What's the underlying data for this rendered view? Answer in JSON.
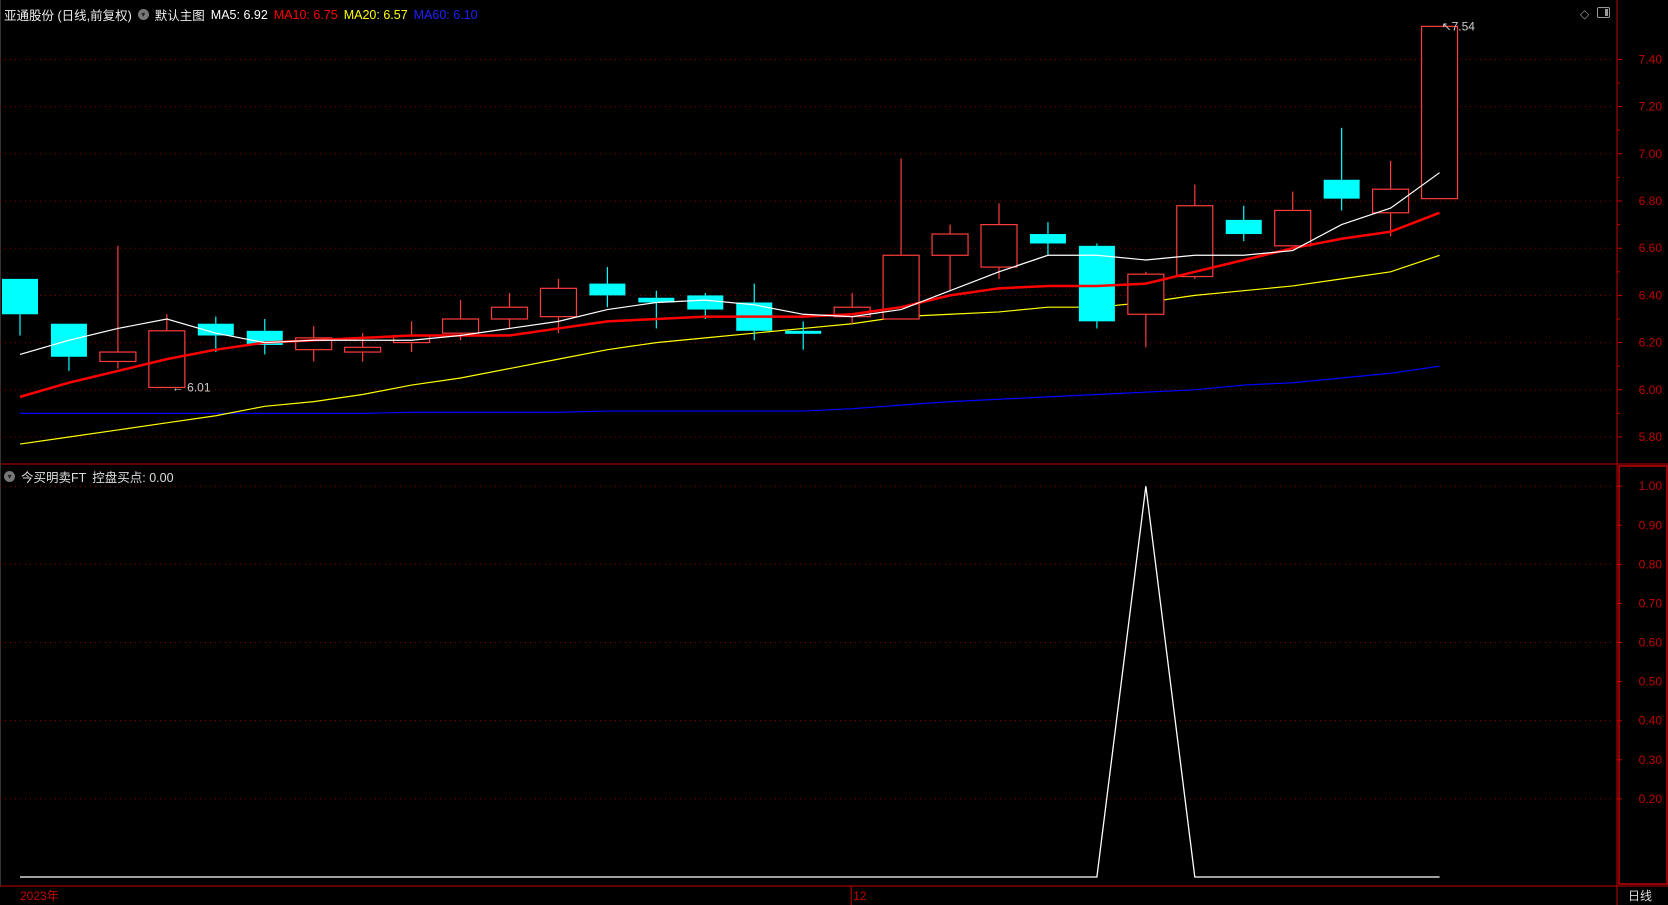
{
  "header": {
    "title": "亚通股份 (日线,前复权)",
    "template": "默认主图",
    "ma5": "MA5: 6.92",
    "ma10": "MA10: 6.75",
    "ma20": "MA20: 6.57",
    "ma60": "MA60: 6.10"
  },
  "indicator_header": {
    "name": "今买明卖FT",
    "value_label": "控盘买点: 0.00"
  },
  "colors": {
    "up": "#ff3b3b",
    "down": "#00ffff",
    "ma5": "#ffffff",
    "ma10": "#ff0000",
    "ma20": "#ffff00",
    "ma60": "#0000ff",
    "axis": "#c00000"
  },
  "x_labels": {
    "year": "2023年",
    "month": "12"
  },
  "period_label": "日线",
  "annotations": {
    "low": "6.01",
    "high": "7.54"
  },
  "chart_data": {
    "type": "candlestick",
    "price_axis": {
      "ticks": [
        "5.80",
        "6.00",
        "6.20",
        "6.40",
        "6.60",
        "6.80",
        "7.00",
        "7.20",
        "7.40"
      ],
      "range": [
        5.73,
        7.62
      ]
    },
    "indicator_axis": {
      "ticks": [
        "0.20",
        "0.30",
        "0.40",
        "0.50",
        "0.60",
        "0.70",
        "0.80",
        "0.90",
        "1.00"
      ],
      "range": [
        0,
        1
      ]
    },
    "ohlc": [
      [
        6.47,
        6.47,
        6.23,
        6.32
      ],
      [
        6.28,
        6.28,
        6.08,
        6.14
      ],
      [
        6.12,
        6.61,
        6.09,
        6.16
      ],
      [
        6.01,
        6.32,
        6.01,
        6.25
      ],
      [
        6.28,
        6.31,
        6.16,
        6.23
      ],
      [
        6.25,
        6.3,
        6.15,
        6.19
      ],
      [
        6.17,
        6.27,
        6.12,
        6.22
      ],
      [
        6.16,
        6.24,
        6.12,
        6.18
      ],
      [
        6.2,
        6.29,
        6.16,
        6.23
      ],
      [
        6.24,
        6.38,
        6.21,
        6.3
      ],
      [
        6.3,
        6.41,
        6.26,
        6.35
      ],
      [
        6.31,
        6.47,
        6.24,
        6.43
      ],
      [
        6.45,
        6.52,
        6.35,
        6.4
      ],
      [
        6.39,
        6.42,
        6.26,
        6.37
      ],
      [
        6.4,
        6.41,
        6.3,
        6.34
      ],
      [
        6.37,
        6.45,
        6.21,
        6.25
      ],
      [
        6.25,
        6.29,
        6.17,
        6.24
      ],
      [
        6.31,
        6.41,
        6.28,
        6.35
      ],
      [
        6.3,
        6.98,
        6.3,
        6.57
      ],
      [
        6.57,
        6.7,
        6.42,
        6.66
      ],
      [
        6.52,
        6.79,
        6.47,
        6.7
      ],
      [
        6.66,
        6.71,
        6.57,
        6.62
      ],
      [
        6.61,
        6.62,
        6.26,
        6.29
      ],
      [
        6.32,
        6.5,
        6.18,
        6.49
      ],
      [
        6.48,
        6.87,
        6.47,
        6.78
      ],
      [
        6.72,
        6.78,
        6.63,
        6.66
      ],
      [
        6.61,
        6.84,
        6.61,
        6.76
      ],
      [
        6.89,
        7.11,
        6.76,
        6.81
      ],
      [
        6.75,
        6.97,
        6.65,
        6.85
      ],
      [
        6.81,
        7.54,
        6.81,
        7.54
      ]
    ],
    "ma5": [
      6.15,
      6.21,
      6.26,
      6.3,
      6.24,
      6.2,
      6.21,
      6.21,
      6.21,
      6.23,
      6.26,
      6.29,
      6.34,
      6.37,
      6.38,
      6.36,
      6.32,
      6.31,
      6.34,
      6.42,
      6.5,
      6.57,
      6.57,
      6.55,
      6.57,
      6.57,
      6.59,
      6.7,
      6.77,
      6.92
    ],
    "ma10": [
      5.97,
      6.03,
      6.08,
      6.13,
      6.17,
      6.2,
      6.21,
      6.22,
      6.23,
      6.23,
      6.23,
      6.26,
      6.29,
      6.3,
      6.31,
      6.31,
      6.31,
      6.32,
      6.35,
      6.4,
      6.43,
      6.44,
      6.44,
      6.45,
      6.5,
      6.55,
      6.6,
      6.64,
      6.67,
      6.75
    ],
    "ma20": [
      5.77,
      5.8,
      5.83,
      5.86,
      5.89,
      5.93,
      5.95,
      5.98,
      6.02,
      6.05,
      6.09,
      6.13,
      6.17,
      6.2,
      6.22,
      6.24,
      6.26,
      6.28,
      6.31,
      6.32,
      6.33,
      6.35,
      6.35,
      6.37,
      6.4,
      6.42,
      6.44,
      6.47,
      6.5,
      6.57
    ],
    "ma60": [
      5.9,
      5.9,
      5.9,
      5.9,
      5.9,
      5.9,
      5.9,
      5.9,
      5.905,
      5.905,
      5.905,
      5.905,
      5.91,
      5.91,
      5.91,
      5.91,
      5.91,
      5.92,
      5.935,
      5.95,
      5.96,
      5.97,
      5.98,
      5.99,
      6.0,
      6.02,
      6.03,
      6.05,
      6.07,
      6.1
    ],
    "indicator": [
      0,
      0,
      0,
      0,
      0,
      0,
      0,
      0,
      0,
      0,
      0,
      0,
      0,
      0,
      0,
      0,
      0,
      0,
      0,
      0,
      0,
      0,
      0,
      1,
      0,
      0,
      0,
      0,
      0,
      0
    ]
  }
}
